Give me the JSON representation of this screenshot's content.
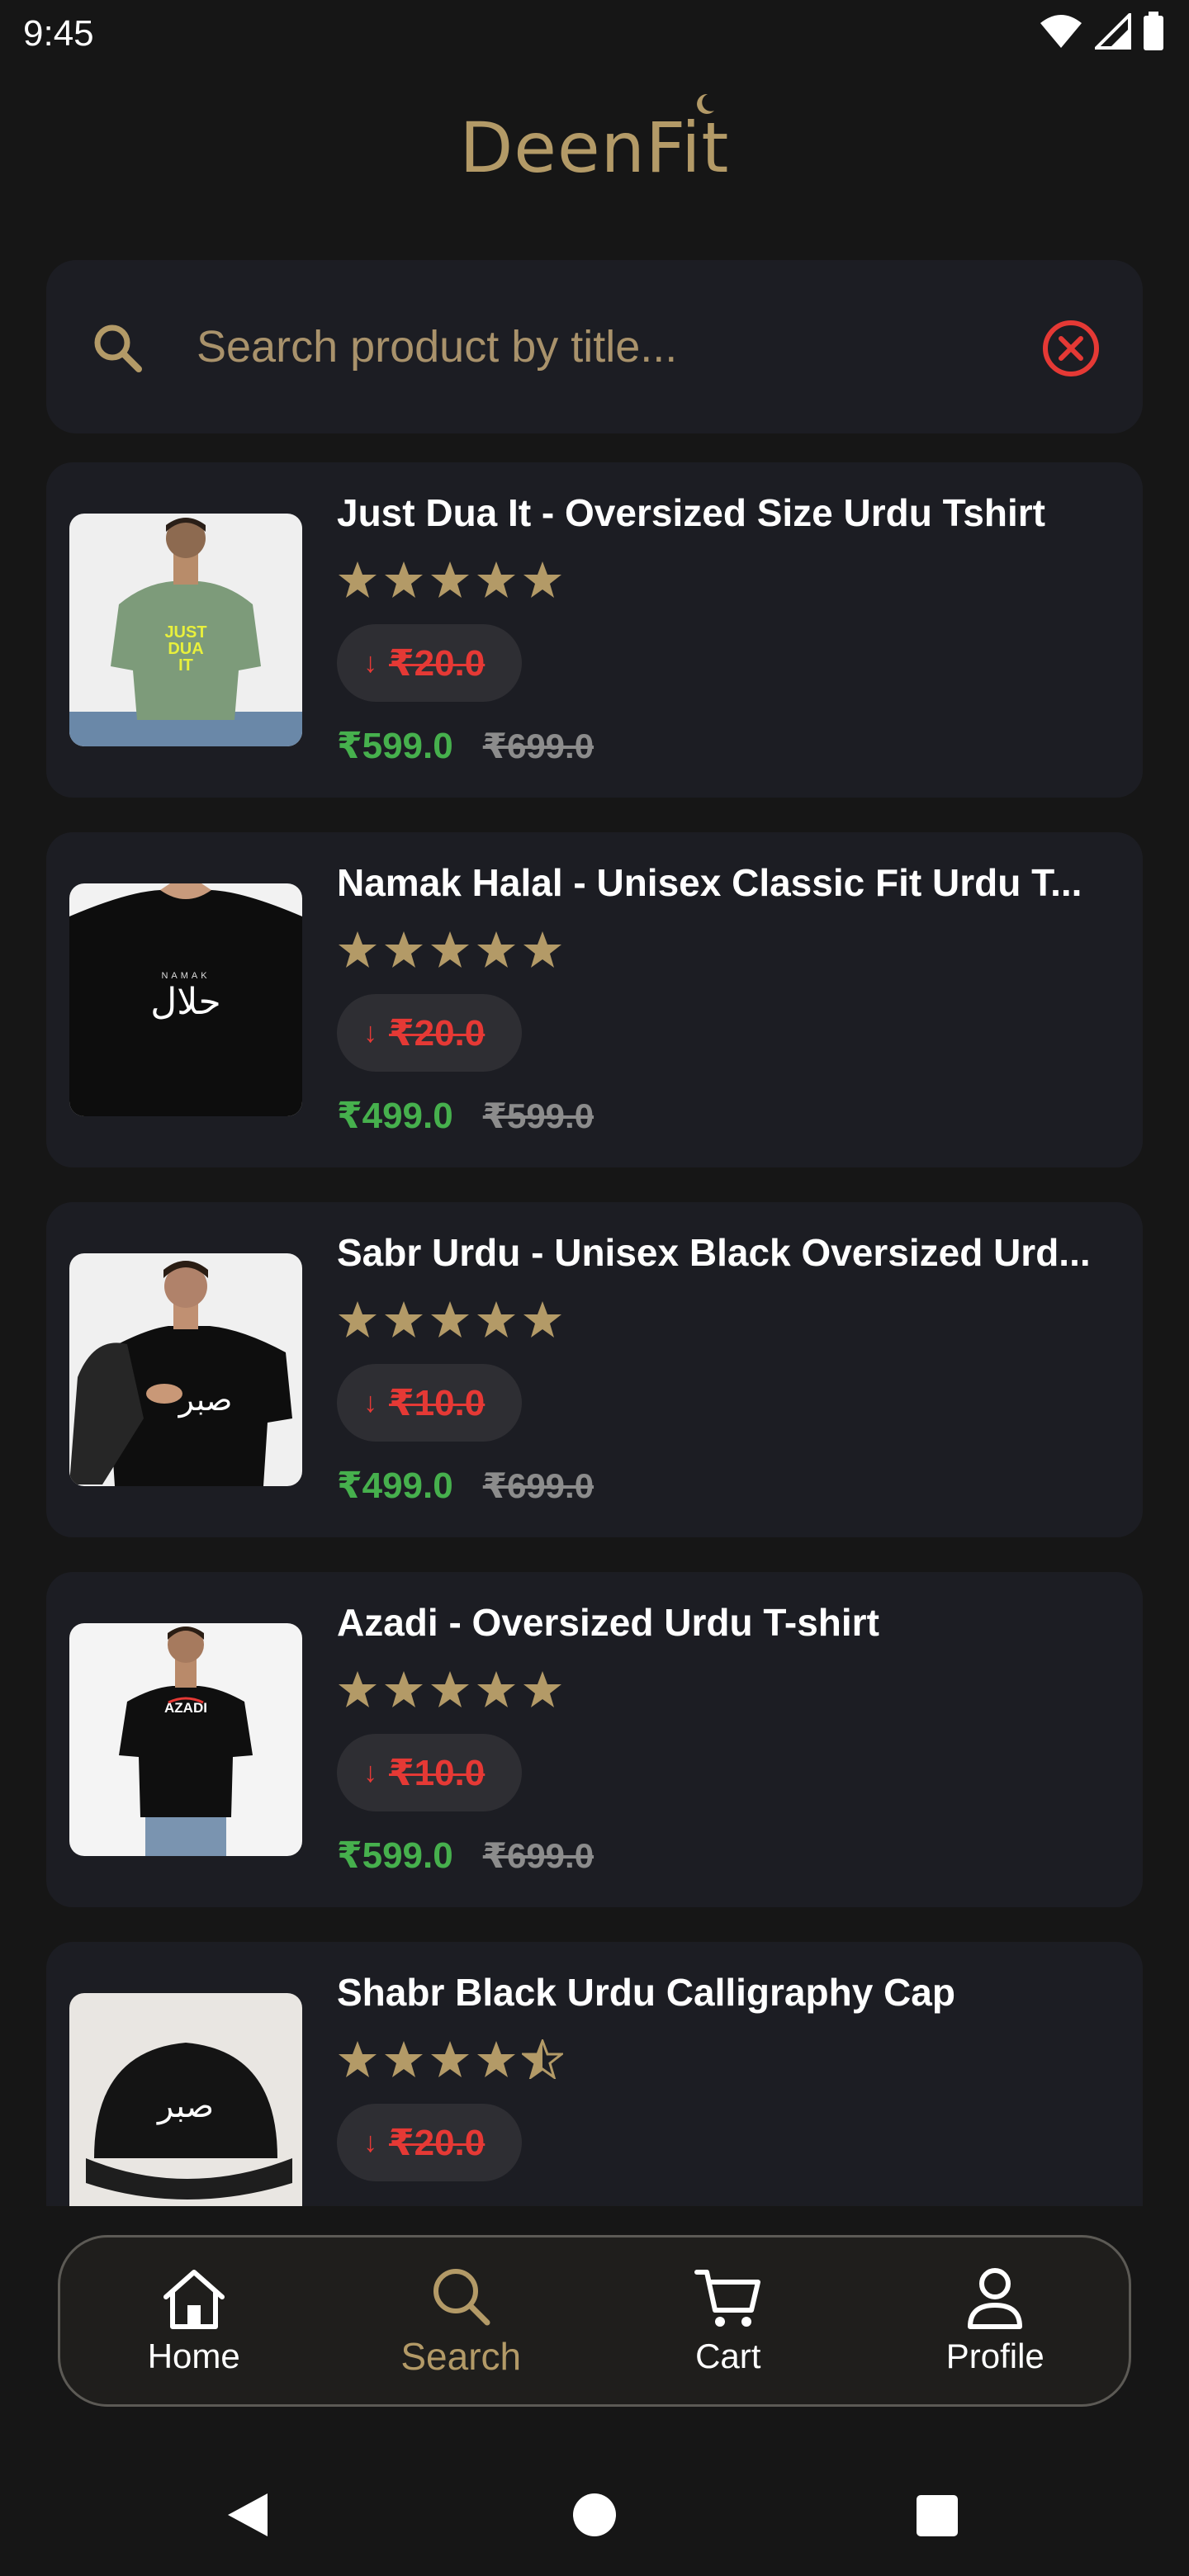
{
  "status": {
    "time": "9:45"
  },
  "brand": {
    "name": "DeenFit",
    "color": "#b39a67"
  },
  "search": {
    "placeholder": "Search product by title...",
    "value": ""
  },
  "products": [
    {
      "title": "Just Dua It - Oversized Size Urdu Tshirt",
      "rating": 5,
      "discount": "₹20.0",
      "price": "₹599.0",
      "old_price": "₹699.0",
      "image": "green-tshirt-model"
    },
    {
      "title": "Namak Halal - Unisex Classic Fit Urdu T...",
      "rating": 5,
      "discount": "₹20.0",
      "price": "₹499.0",
      "old_price": "₹599.0",
      "image": "black-tshirt-halal"
    },
    {
      "title": "Sabr Urdu - Unisex Black Oversized Urd...",
      "rating": 5,
      "discount": "₹10.0",
      "price": "₹499.0",
      "old_price": "₹699.0",
      "image": "black-tshirt-sabr"
    },
    {
      "title": "Azadi - Oversized Urdu T-shirt",
      "rating": 5,
      "discount": "₹10.0",
      "price": "₹599.0",
      "old_price": "₹699.0",
      "image": "black-tshirt-azadi"
    },
    {
      "title": "Shabr Black Urdu Calligraphy Cap",
      "rating": 4.5,
      "discount": "₹20.0",
      "price": "",
      "old_price": "",
      "image": "black-cap-sabr"
    }
  ],
  "nav": {
    "items": [
      {
        "label": "Home",
        "icon": "home-icon",
        "active": false
      },
      {
        "label": "Search",
        "icon": "search-icon",
        "active": true
      },
      {
        "label": "Cart",
        "icon": "cart-icon",
        "active": false
      },
      {
        "label": "Profile",
        "icon": "profile-icon",
        "active": false
      }
    ]
  },
  "colors": {
    "accent": "#b39a67",
    "price": "#46b04d",
    "discount": "#e53935",
    "card": "#1c1d23",
    "background": "#161616"
  }
}
